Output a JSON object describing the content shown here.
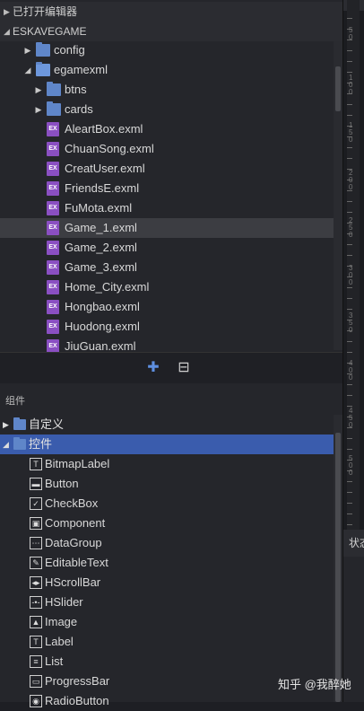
{
  "explorer": {
    "open_editors_label": "已打开编辑器",
    "project_label": "ESKAVEGAME",
    "tree": [
      {
        "label": "config",
        "kind": "folder",
        "depth": 1,
        "expanded": false
      },
      {
        "label": "egamexml",
        "kind": "folder",
        "depth": 1,
        "expanded": true
      },
      {
        "label": "btns",
        "kind": "folder",
        "depth": 2,
        "expanded": false
      },
      {
        "label": "cards",
        "kind": "folder",
        "depth": 2,
        "expanded": false
      },
      {
        "label": "AleartBox.exml",
        "kind": "exml",
        "depth": 2
      },
      {
        "label": "ChuanSong.exml",
        "kind": "exml",
        "depth": 2
      },
      {
        "label": "CreatUser.exml",
        "kind": "exml",
        "depth": 2
      },
      {
        "label": "FriendsE.exml",
        "kind": "exml",
        "depth": 2
      },
      {
        "label": "FuMota.exml",
        "kind": "exml",
        "depth": 2
      },
      {
        "label": "Game_1.exml",
        "kind": "exml",
        "depth": 2,
        "selected": true
      },
      {
        "label": "Game_2.exml",
        "kind": "exml",
        "depth": 2
      },
      {
        "label": "Game_3.exml",
        "kind": "exml",
        "depth": 2
      },
      {
        "label": "Home_City.exml",
        "kind": "exml",
        "depth": 2
      },
      {
        "label": "Hongbao.exml",
        "kind": "exml",
        "depth": 2
      },
      {
        "label": "Huodong.exml",
        "kind": "exml",
        "depth": 2
      },
      {
        "label": "JiuGuan.exml",
        "kind": "exml",
        "depth": 2
      }
    ]
  },
  "toolbar": {
    "components_icon": "puzzle-icon",
    "assets_icon": "library-icon"
  },
  "components": {
    "title": "组件",
    "groups": [
      {
        "label": "自定义",
        "expanded": false
      },
      {
        "label": "控件",
        "expanded": true,
        "selected": true
      }
    ],
    "items": [
      {
        "label": "BitmapLabel",
        "icon": "T"
      },
      {
        "label": "Button",
        "icon": "▬"
      },
      {
        "label": "CheckBox",
        "icon": "✓"
      },
      {
        "label": "Component",
        "icon": "▣"
      },
      {
        "label": "DataGroup",
        "icon": "⋯"
      },
      {
        "label": "EditableText",
        "icon": "✎"
      },
      {
        "label": "HScrollBar",
        "icon": "◂▸"
      },
      {
        "label": "HSlider",
        "icon": "-•-"
      },
      {
        "label": "Image",
        "icon": "▲"
      },
      {
        "label": "Label",
        "icon": "T"
      },
      {
        "label": "List",
        "icon": "≡"
      },
      {
        "label": "ProgressBar",
        "icon": "▭"
      },
      {
        "label": "RadioButton",
        "icon": "◉"
      }
    ]
  },
  "right_panel": {
    "props_title": "状态",
    "ruler_labels": [
      "50",
      "100",
      "150",
      "200",
      "250",
      "300",
      "350",
      "400",
      "450",
      "500"
    ]
  },
  "watermark": "知乎 @我醉她",
  "colors": {
    "selection_blue": "#3a5cad",
    "exml_purple": "#8a4fc2",
    "folder_blue": "#5f86c9"
  }
}
